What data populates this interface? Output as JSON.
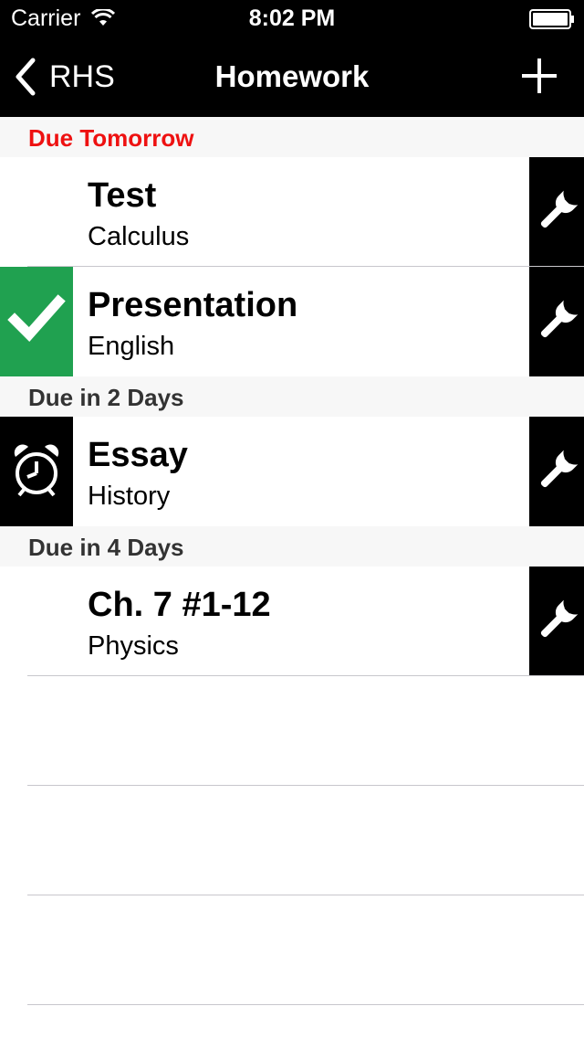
{
  "status_bar": {
    "carrier": "Carrier",
    "time": "8:02 PM",
    "icons": [
      "wifi-icon",
      "battery-icon"
    ]
  },
  "nav": {
    "back_label": "RHS",
    "title": "Homework",
    "add_icon": "plus-icon"
  },
  "colors": {
    "bar_background": "#000000",
    "section_background": "#f7f7f7",
    "due_tomorrow": "#ee1111",
    "done_green": "#20a150",
    "separator": "#c8c7cc"
  },
  "sections": [
    {
      "header": "Due Tomorrow",
      "header_color": "#ee1111",
      "items": [
        {
          "title": "Test",
          "subject": "Calculus",
          "status": "none"
        },
        {
          "title": "Presentation",
          "subject": "English",
          "status": "done",
          "status_icon": "checkmark-icon"
        }
      ]
    },
    {
      "header": "Due in 2 Days",
      "header_color": "#333333",
      "items": [
        {
          "title": "Essay",
          "subject": "History",
          "status": "reminder",
          "status_icon": "alarm-clock-icon"
        }
      ]
    },
    {
      "header": "Due in 4 Days",
      "header_color": "#333333",
      "items": [
        {
          "title": "Ch. 7 #1-12",
          "subject": "Physics",
          "status": "none"
        }
      ]
    }
  ],
  "row_action_icon": "wrench-icon"
}
